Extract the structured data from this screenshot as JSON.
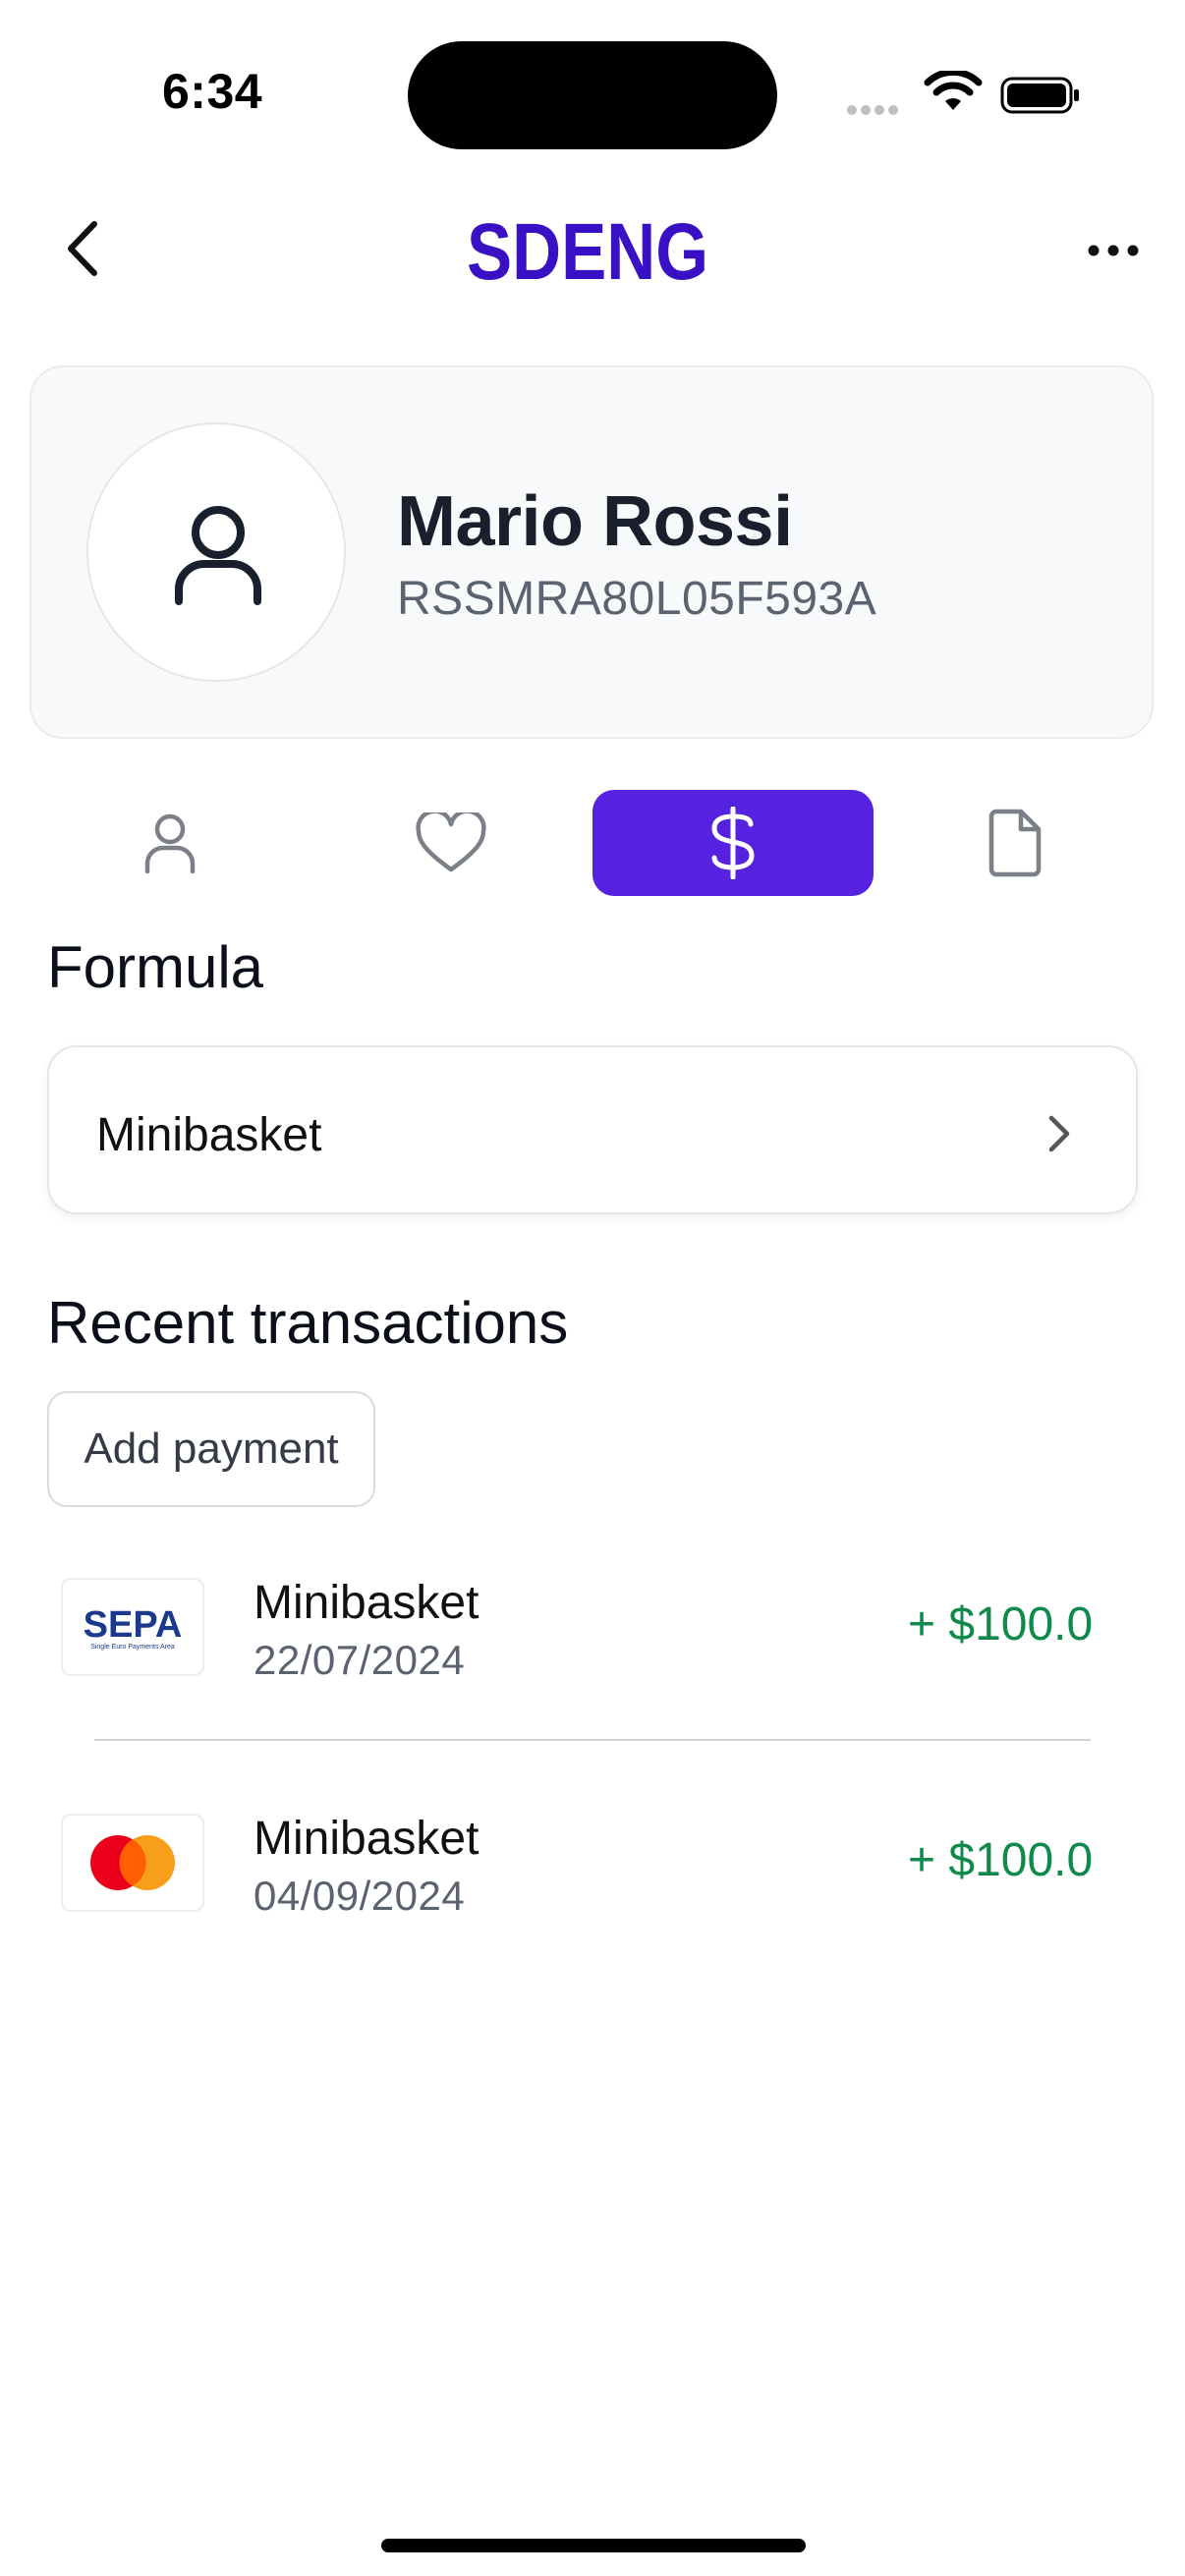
{
  "status_bar": {
    "time": "6:34"
  },
  "header": {
    "logo_text": "SDENG"
  },
  "profile": {
    "name": "Mario Rossi",
    "code": "RSSMRA80L05F593A"
  },
  "tabs": [
    {
      "icon": "person-icon",
      "active": false
    },
    {
      "icon": "heart-icon",
      "active": false
    },
    {
      "icon": "dollar-icon",
      "active": true
    },
    {
      "icon": "document-icon",
      "active": false
    }
  ],
  "formula": {
    "title": "Formula",
    "value": "Minibasket"
  },
  "transactions": {
    "title": "Recent transactions",
    "add_label": "Add payment",
    "items": [
      {
        "method": "sepa-logo",
        "logo_text": "SEPA",
        "logo_subtext": "Single Euro Payments Area",
        "name": "Minibasket",
        "date": "22/07/2024",
        "amount": "+ $100.0"
      },
      {
        "method": "mastercard-logo",
        "name": "Minibasket",
        "date": "04/09/2024",
        "amount": "+ $100.0"
      }
    ]
  },
  "colors": {
    "accent": "#5522e0",
    "logo": "#3a10c4",
    "positive": "#0f8a4c"
  }
}
